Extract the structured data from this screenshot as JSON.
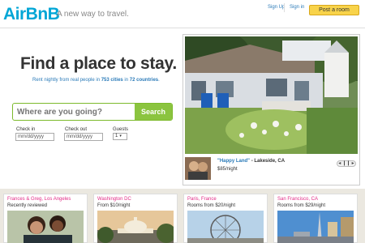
{
  "header": {
    "logo": "AirBnB",
    "tagline": "A new way to travel.",
    "signup_label": "Sign Up",
    "signin_label": "Sign in",
    "post_button": "Post a room"
  },
  "hero": {
    "headline": "Find a place to stay.",
    "subline_prefix": "Rent nightly from real people in ",
    "cities": "753 cities",
    "subline_mid": " in ",
    "countries": "72 countries",
    "subline_suffix": "."
  },
  "search": {
    "placeholder": "Where are you going?",
    "button_label": "Search",
    "checkin_label": "Check in",
    "checkin_placeholder": "mm/dd/yyyy",
    "checkout_label": "Check out",
    "checkout_placeholder": "mm/dd/yyyy",
    "guests_label": "Guests",
    "guests_value": "1"
  },
  "feature": {
    "listing_name": "\"Happy Land\"",
    "location": " - Lakeside, CA",
    "price": "$85/night",
    "controls": "◂ ❙❙ ▸"
  },
  "cards": [
    {
      "title": "Frances & Greg, Los Angeles",
      "subtitle": "Recently reviewed"
    },
    {
      "title": "Washington DC",
      "subtitle": "From $10/night"
    },
    {
      "title": "Paris, France",
      "subtitle": "Rooms from $20/night"
    },
    {
      "title": "San Francisco, CA",
      "subtitle": "Rooms from $29/night"
    }
  ],
  "colors": {
    "logo_blue": "#00a6d6",
    "accent_pink": "#e22b87",
    "search_green": "#8bc43f",
    "post_yellow": "#f8d34a",
    "link_blue": "#2a7ab8"
  }
}
